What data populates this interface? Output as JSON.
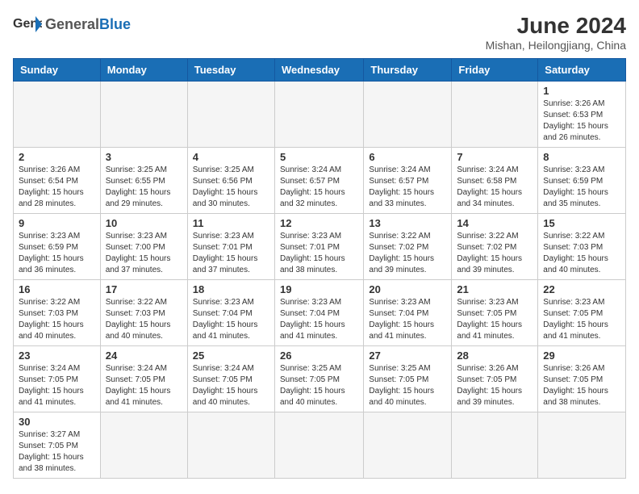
{
  "header": {
    "logo_general": "General",
    "logo_blue": "Blue",
    "month_title": "June 2024",
    "subtitle": "Mishan, Heilongjiang, China"
  },
  "weekdays": [
    "Sunday",
    "Monday",
    "Tuesday",
    "Wednesday",
    "Thursday",
    "Friday",
    "Saturday"
  ],
  "weeks": [
    [
      {
        "day": "",
        "info": ""
      },
      {
        "day": "",
        "info": ""
      },
      {
        "day": "",
        "info": ""
      },
      {
        "day": "",
        "info": ""
      },
      {
        "day": "",
        "info": ""
      },
      {
        "day": "",
        "info": ""
      },
      {
        "day": "1",
        "info": "Sunrise: 3:26 AM\nSunset: 6:53 PM\nDaylight: 15 hours\nand 26 minutes."
      }
    ],
    [
      {
        "day": "2",
        "info": "Sunrise: 3:26 AM\nSunset: 6:54 PM\nDaylight: 15 hours\nand 28 minutes."
      },
      {
        "day": "3",
        "info": "Sunrise: 3:25 AM\nSunset: 6:55 PM\nDaylight: 15 hours\nand 29 minutes."
      },
      {
        "day": "4",
        "info": "Sunrise: 3:25 AM\nSunset: 6:56 PM\nDaylight: 15 hours\nand 30 minutes."
      },
      {
        "day": "5",
        "info": "Sunrise: 3:24 AM\nSunset: 6:57 PM\nDaylight: 15 hours\nand 32 minutes."
      },
      {
        "day": "6",
        "info": "Sunrise: 3:24 AM\nSunset: 6:57 PM\nDaylight: 15 hours\nand 33 minutes."
      },
      {
        "day": "7",
        "info": "Sunrise: 3:24 AM\nSunset: 6:58 PM\nDaylight: 15 hours\nand 34 minutes."
      },
      {
        "day": "8",
        "info": "Sunrise: 3:23 AM\nSunset: 6:59 PM\nDaylight: 15 hours\nand 35 minutes."
      }
    ],
    [
      {
        "day": "9",
        "info": "Sunrise: 3:23 AM\nSunset: 6:59 PM\nDaylight: 15 hours\nand 36 minutes."
      },
      {
        "day": "10",
        "info": "Sunrise: 3:23 AM\nSunset: 7:00 PM\nDaylight: 15 hours\nand 37 minutes."
      },
      {
        "day": "11",
        "info": "Sunrise: 3:23 AM\nSunset: 7:01 PM\nDaylight: 15 hours\nand 37 minutes."
      },
      {
        "day": "12",
        "info": "Sunrise: 3:23 AM\nSunset: 7:01 PM\nDaylight: 15 hours\nand 38 minutes."
      },
      {
        "day": "13",
        "info": "Sunrise: 3:22 AM\nSunset: 7:02 PM\nDaylight: 15 hours\nand 39 minutes."
      },
      {
        "day": "14",
        "info": "Sunrise: 3:22 AM\nSunset: 7:02 PM\nDaylight: 15 hours\nand 39 minutes."
      },
      {
        "day": "15",
        "info": "Sunrise: 3:22 AM\nSunset: 7:03 PM\nDaylight: 15 hours\nand 40 minutes."
      }
    ],
    [
      {
        "day": "16",
        "info": "Sunrise: 3:22 AM\nSunset: 7:03 PM\nDaylight: 15 hours\nand 40 minutes."
      },
      {
        "day": "17",
        "info": "Sunrise: 3:22 AM\nSunset: 7:03 PM\nDaylight: 15 hours\nand 40 minutes."
      },
      {
        "day": "18",
        "info": "Sunrise: 3:23 AM\nSunset: 7:04 PM\nDaylight: 15 hours\nand 41 minutes."
      },
      {
        "day": "19",
        "info": "Sunrise: 3:23 AM\nSunset: 7:04 PM\nDaylight: 15 hours\nand 41 minutes."
      },
      {
        "day": "20",
        "info": "Sunrise: 3:23 AM\nSunset: 7:04 PM\nDaylight: 15 hours\nand 41 minutes."
      },
      {
        "day": "21",
        "info": "Sunrise: 3:23 AM\nSunset: 7:05 PM\nDaylight: 15 hours\nand 41 minutes."
      },
      {
        "day": "22",
        "info": "Sunrise: 3:23 AM\nSunset: 7:05 PM\nDaylight: 15 hours\nand 41 minutes."
      }
    ],
    [
      {
        "day": "23",
        "info": "Sunrise: 3:24 AM\nSunset: 7:05 PM\nDaylight: 15 hours\nand 41 minutes."
      },
      {
        "day": "24",
        "info": "Sunrise: 3:24 AM\nSunset: 7:05 PM\nDaylight: 15 hours\nand 41 minutes."
      },
      {
        "day": "25",
        "info": "Sunrise: 3:24 AM\nSunset: 7:05 PM\nDaylight: 15 hours\nand 40 minutes."
      },
      {
        "day": "26",
        "info": "Sunrise: 3:25 AM\nSunset: 7:05 PM\nDaylight: 15 hours\nand 40 minutes."
      },
      {
        "day": "27",
        "info": "Sunrise: 3:25 AM\nSunset: 7:05 PM\nDaylight: 15 hours\nand 40 minutes."
      },
      {
        "day": "28",
        "info": "Sunrise: 3:26 AM\nSunset: 7:05 PM\nDaylight: 15 hours\nand 39 minutes."
      },
      {
        "day": "29",
        "info": "Sunrise: 3:26 AM\nSunset: 7:05 PM\nDaylight: 15 hours\nand 38 minutes."
      }
    ],
    [
      {
        "day": "30",
        "info": "Sunrise: 3:27 AM\nSunset: 7:05 PM\nDaylight: 15 hours\nand 38 minutes."
      },
      {
        "day": "",
        "info": ""
      },
      {
        "day": "",
        "info": ""
      },
      {
        "day": "",
        "info": ""
      },
      {
        "day": "",
        "info": ""
      },
      {
        "day": "",
        "info": ""
      },
      {
        "day": "",
        "info": ""
      }
    ]
  ]
}
